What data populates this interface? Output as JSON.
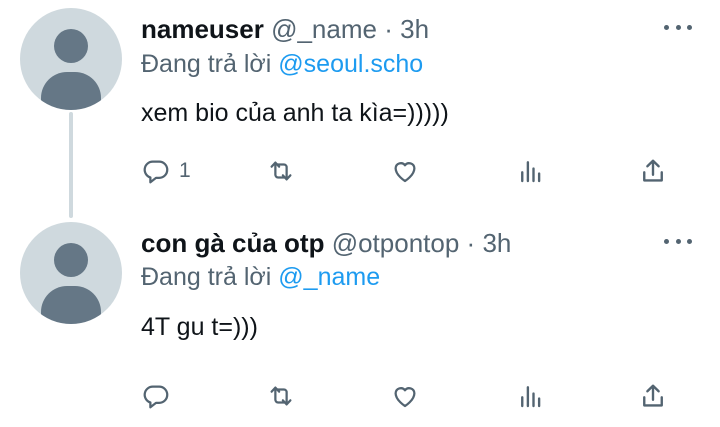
{
  "tweets": [
    {
      "display_name": "nameuser",
      "handle": "@_name",
      "separator": "·",
      "time": "3h",
      "replying_label": "Đang trả lời",
      "replying_to": "@seoul.scho",
      "text": "xem bio của anh ta kìa=)))))",
      "reply_count": "1",
      "retweet_count": "",
      "like_count": ""
    },
    {
      "display_name": "con gà của otp",
      "handle": "@otpontop",
      "separator": "·",
      "time": "3h",
      "replying_label": "Đang trả lời",
      "replying_to": "@_name",
      "text": "4T gu t=)))",
      "reply_count": "",
      "retweet_count": "",
      "like_count": ""
    }
  ],
  "icons": [
    "reply-icon",
    "retweet-icon",
    "like-icon",
    "views-icon",
    "share-icon",
    "more-icon"
  ],
  "colors": {
    "text_primary": "#0f1419",
    "text_secondary": "#536471",
    "mention": "#1d9bf0",
    "avatar_bg": "#cfd9de",
    "avatar_fg": "#657786"
  }
}
